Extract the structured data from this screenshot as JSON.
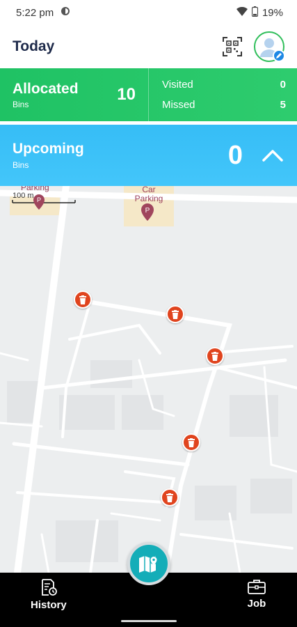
{
  "status_bar": {
    "time": "5:22 pm",
    "battery": "19%"
  },
  "header": {
    "title": "Today"
  },
  "allocated": {
    "title": "Allocated",
    "subtitle": "Bins",
    "count": "10",
    "visited_label": "Visited",
    "visited_value": "0",
    "missed_label": "Missed",
    "missed_value": "5"
  },
  "upcoming": {
    "title": "Upcoming",
    "subtitle": "Bins",
    "count": "0"
  },
  "map": {
    "scale_label": "100 m",
    "poi_1": "Parking",
    "poi_2_line1": "Car",
    "poi_2_line2": "Parking"
  },
  "bins": [
    {
      "id": "bin-1"
    },
    {
      "id": "bin-2"
    },
    {
      "id": "bin-3"
    },
    {
      "id": "bin-4"
    },
    {
      "id": "bin-5"
    }
  ],
  "bottom_nav": {
    "history_label": "History",
    "job_label": "Job"
  },
  "colors": {
    "allocated_green": "#1fc264",
    "upcoming_blue": "#36bdf6",
    "bin_marker": "#e0441e",
    "fab": "#14adb8"
  }
}
